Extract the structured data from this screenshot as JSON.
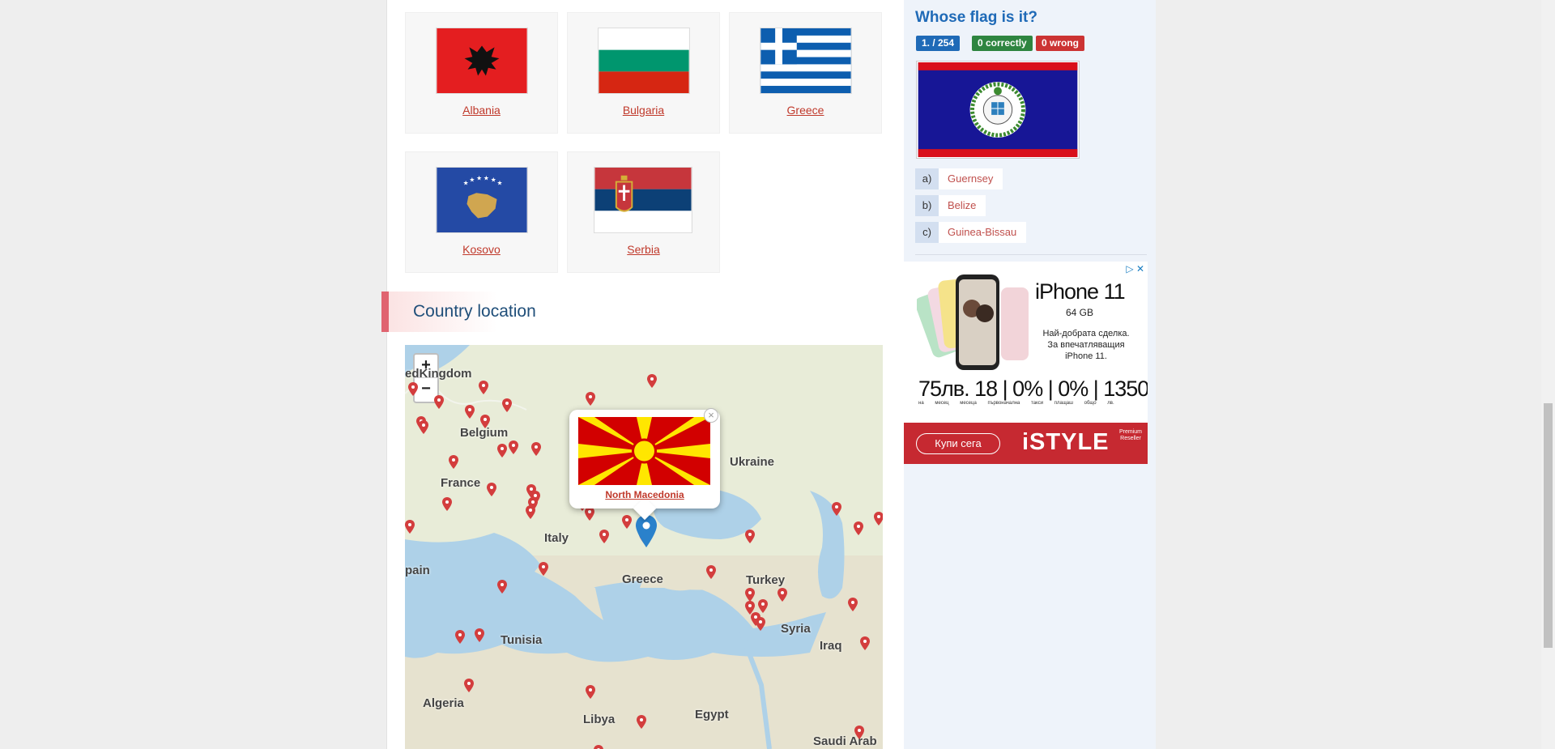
{
  "neighbors": [
    {
      "name": "Albania",
      "flag": "albania"
    },
    {
      "name": "Bulgaria",
      "flag": "bulgaria"
    },
    {
      "name": "Greece",
      "flag": "greece"
    },
    {
      "name": "Kosovo",
      "flag": "kosovo"
    },
    {
      "name": "Serbia",
      "flag": "serbia"
    }
  ],
  "section": {
    "title": "Country location"
  },
  "map": {
    "zoom_in": "+",
    "zoom_out": "−",
    "labels": [
      "edKingdom",
      "Belgium",
      "France",
      "Italy",
      "Ukraine",
      "Turkey",
      "Greece",
      "Syria",
      "Iraq",
      "Tunisia",
      "Algeria",
      "Libya",
      "Egypt",
      "Saudi Arab",
      "pain"
    ],
    "popup": {
      "country": "North Macedonia",
      "close": "×"
    }
  },
  "quiz": {
    "title": "Whose flag is it?",
    "progress": "1. / 254",
    "correct": "0  correctly",
    "wrong": "0  wrong",
    "answers": [
      {
        "letter": "a)",
        "text": "Guernsey"
      },
      {
        "letter": "b)",
        "text": "Belize"
      },
      {
        "letter": "c)",
        "text": "Guinea-Bissau"
      }
    ]
  },
  "ad": {
    "title": "iPhone 11",
    "storage": "64 GB",
    "text": "Най-добрата сделка. За впечатляващия iPhone 11.",
    "prices": "75лв.  18 | 0% | 0% | 1350",
    "price_labels": "на месец месеца първоначална такси плащаш общо лв.",
    "button": "Купи сега",
    "brand": "iSTYLE",
    "reseller": "Premium Reseller"
  },
  "colors": {
    "accent": "#1f6ab7",
    "link": "#c0392b",
    "correct": "#2e8540",
    "wrong": "#cc3333",
    "progress": "#1f6ab7"
  }
}
